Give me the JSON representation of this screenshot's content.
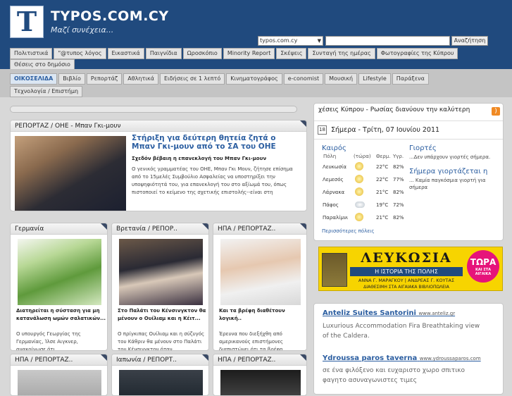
{
  "header": {
    "site_name": "TYPOS.COM.CY",
    "tagline": "Μαζί συνέχεια...",
    "logo_letter": "T",
    "search_scope": "typos.com.cy",
    "search_button": "Αναζήτηση"
  },
  "nav_primary": [
    "Πολιτιστικά",
    "\"@τυπος λόγος",
    "Εικαστικά",
    "Παιγνίδια",
    "Ωροσκόπιο",
    "Minority Report",
    "Σκέψεις",
    "Συνταγή της ημέρας",
    "Φωτογραφίες της Κύπρου",
    "Θέσεις στο δημόσιο"
  ],
  "nav_secondary": [
    "ΟΙΚΟΣΕΛΙΔΑ",
    "Βιβλίο",
    "Ρεπορτάζ",
    "Αθλητικά",
    "Ειδήσεις σε 1 λεπτό",
    "Κινηματογράφος",
    "e-conomist",
    "Μουσική",
    "Lifestyle",
    "Παράξενα",
    "Τεχνολογία / Επιστήμη"
  ],
  "featured": {
    "section_title": "ΡΕΠΟΡΤΑΖ / ΟΗΕ - Μπαν Γκι-μουν",
    "headline": "Στήριξη για δεύτερη θητεία ζητά ο Μπαν Γκι-μουν από το ΣΑ του ΟΗΕ",
    "subhead": "Σχεδόν βέβαιη η επανεκλογή του Μπαν Γκι-μουν",
    "body": "Ο γενικός γραμματέας του ΟΗΕ, Μπαν Γκι Μουν, ζήτησε επίσημα από το 15μελές Συμβούλιο Ασφαλείας να υποστηρίξει την υποψηφιότητά του, για επανεκλογή του στο αξίωμά του, όπως πιστοποιεί το κείμενο της σχετικής επιστολής--είναι στη"
  },
  "news_cards": [
    {
      "title": "Γερμανία",
      "caption": "Διατηρείται η σύσταση για μη κατανάλωση ωμών σαλατικών...",
      "body": "Ο υπουργός Γεωργίας της Γερμανίας, Ίλσε Αιγκνερ, ανακοίνωσε ότι..."
    },
    {
      "title": "Βρετανία / ΡΕΠΟΡ..",
      "caption": "Στο Παλάτι του Κένσινγκτον θα μένουν ο Ουίλιαμ και η Κέιτ...",
      "body": "Ο πρίγκιπας Ουίλιαμ και η σύζυγός του Κάθριν θα μένουν στο Παλάτι του Κένσινγκτον όταν..."
    },
    {
      "title": "ΗΠΑ / ΡΕΠΟΡΤΑΖ..",
      "caption": "Και τα βρέφη διαθέτουν λογική..",
      "body": "Έρευνα που διεξήχθη από αμερικανούς επιστήμονες διαπιστώνει ότι τα βρέφη αντιλαμβάνονται..."
    }
  ],
  "news_row2": [
    "ΗΠΑ / ΡΕΠΟΡΤΑΖ..",
    "Ιαπωνία / ΡΕΠΟΡΤ..",
    "ΗΠΑ / ΡΕΠΟΡΤΑΖ.."
  ],
  "right_column": {
    "headline": "χέσεις Κύπρου - Ρωσίας διανύουν την καλύτερη",
    "calendar_day": "18",
    "date": "Σήμερα - Τρίτη, 07 Ιουνίου 2011",
    "weather": {
      "title": "Καιρός",
      "headers": [
        "Πόλη",
        "(τώρα)",
        "Θερμ.",
        "Υγρ."
      ],
      "rows": [
        {
          "city": "Λευκωσία",
          "icon": "sun-icon",
          "temp": "22°C",
          "hum": "82%"
        },
        {
          "city": "Λεμεσός",
          "icon": "sun-icon",
          "temp": "22°C",
          "hum": "77%"
        },
        {
          "city": "Λάρνακα",
          "icon": "sun-icon",
          "temp": "21°C",
          "hum": "82%"
        },
        {
          "city": "Πάφος",
          "icon": "cloud-icon",
          "temp": "19°C",
          "hum": "72%"
        },
        {
          "city": "Παραλίμνι",
          "icon": "sun-icon",
          "temp": "21°C",
          "hum": "82%"
        }
      ],
      "more": "Περισσότερες πόλεις"
    },
    "names": {
      "title": "Γιορτές",
      "text": "...Δεν υπάρχουν γιορτές σήμερα.",
      "title2": "Σήμερα γιορτάζεται η",
      "text2a": "... Καμία παγκόσμια γιορτή για",
      "text2b": "σήμερα"
    },
    "ad": {
      "title": "ΛΕΥΚΩΣΙΑ",
      "subtitle": "Η ΙΣΤΟΡΙΑ ΤΗΣ ΠΟΛΗΣ",
      "authors": "ΑΝΝΑ Γ. ΜΑΡΑΓΚΟΥ | ΑΝΔΡΕΑΣ Γ. ΚΟΥΤΑΣ",
      "availability": "ΔΙΑΘΕΣΙΜΗ ΣΤΑ ΑΙΓΑΙΑΚΑ ΒΙΒΛΙΟΠΩΛΕΙΑ",
      "badge_top": "ΤΩΡΑ",
      "badge_bottom": "ΚΑΙ ΣΤΑ ΑΙΓΑΙΚΑ"
    },
    "sponsored": [
      {
        "title": "Anteliz Suites Santorini",
        "url": "www.anteliz.gr",
        "desc1": "Luxurious Accommodation Fira Breathtaking view",
        "desc2": "of the Caldera."
      },
      {
        "title": "Ydroussa paros taverna",
        "url": "www.ydroussaparos.com",
        "desc1": "σε ένα φιλόξενο και ευχαριστο χωρο σπιτικο",
        "desc2": "φαγητο ασυναγωνιστες τιμες"
      }
    ]
  }
}
